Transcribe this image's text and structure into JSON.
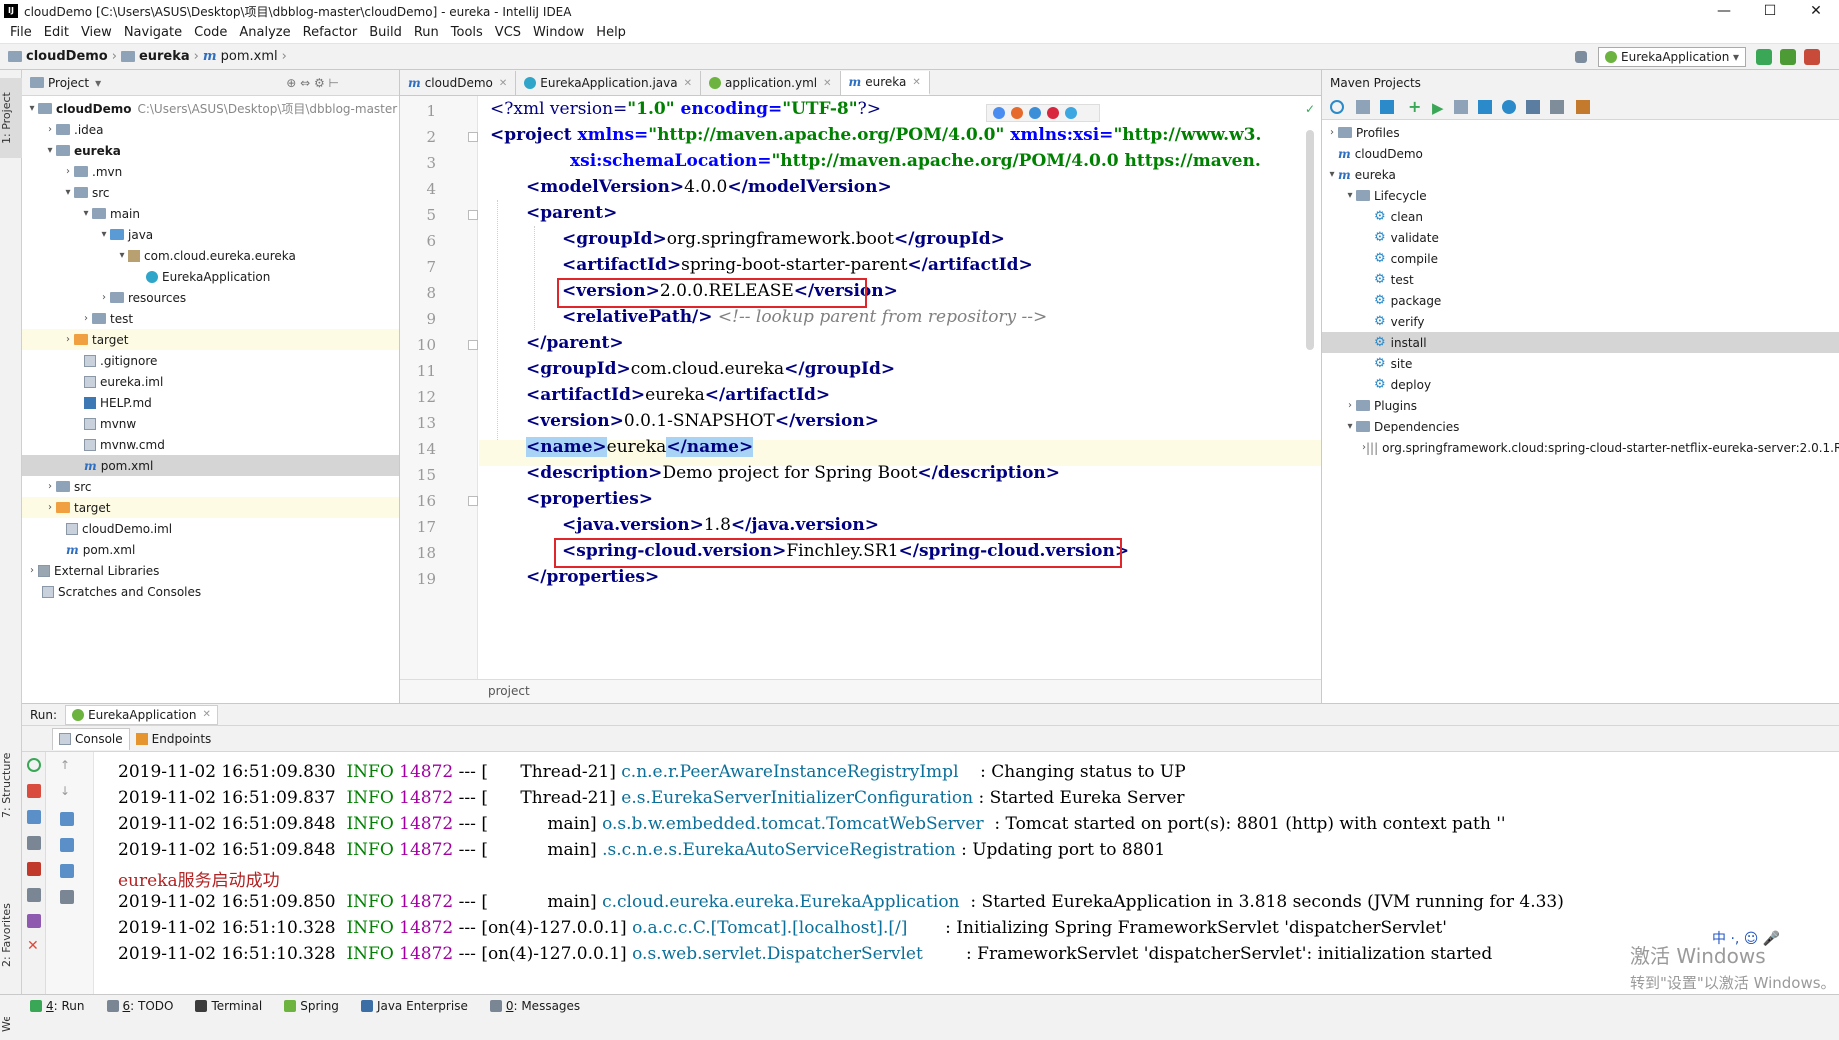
{
  "window": {
    "title": "cloudDemo [C:\\Users\\ASUS\\Desktop\\项目\\dbblog-master\\cloudDemo] - eureka - IntelliJ IDEA",
    "minimize": "—",
    "maximize": "☐",
    "close": "✕"
  },
  "menu": [
    "File",
    "Edit",
    "View",
    "Navigate",
    "Code",
    "Analyze",
    "Refactor",
    "Build",
    "Run",
    "Tools",
    "VCS",
    "Window",
    "Help"
  ],
  "breadcrumb": [
    "cloudDemo",
    "eureka",
    "pom.xml"
  ],
  "run_config": "EurekaApplication",
  "left_strip": {
    "project": "1: Project",
    "structure": "7: Structure",
    "favorites": "2: Favorites",
    "web": "Web"
  },
  "project_panel": {
    "title": "Project",
    "tree": [
      {
        "label": "cloudDemo",
        "extra": "C:\\Users\\ASUS\\Desktop\\项目\\dbblog-master",
        "bold": true
      },
      {
        "label": ".idea"
      },
      {
        "label": "eureka",
        "bold": true
      },
      {
        "label": ".mvn"
      },
      {
        "label": "src"
      },
      {
        "label": "main"
      },
      {
        "label": "java"
      },
      {
        "label": "com.cloud.eureka.eureka"
      },
      {
        "label": "EurekaApplication"
      },
      {
        "label": "resources"
      },
      {
        "label": "test"
      },
      {
        "label": "target"
      },
      {
        "label": ".gitignore"
      },
      {
        "label": "eureka.iml"
      },
      {
        "label": "HELP.md"
      },
      {
        "label": "mvnw"
      },
      {
        "label": "mvnw.cmd"
      },
      {
        "label": "pom.xml"
      },
      {
        "label": "src"
      },
      {
        "label": "target"
      },
      {
        "label": "cloudDemo.iml"
      },
      {
        "label": "pom.xml"
      },
      {
        "label": "External Libraries"
      },
      {
        "label": "Scratches and Consoles"
      }
    ]
  },
  "editor": {
    "tabs": [
      "cloudDemo",
      "EurekaApplication.java",
      "application.yml",
      "eureka"
    ],
    "active_tab": "eureka",
    "line_numbers": [
      "1",
      "2",
      "3",
      "4",
      "5",
      "6",
      "7",
      "8",
      "9",
      "10",
      "11",
      "12",
      "13",
      "14",
      "15",
      "16",
      "17",
      "18",
      "19"
    ],
    "lines": {
      "l1": [
        "<?xml version=",
        "\"1.0\"",
        " encoding=",
        "\"UTF-8\"",
        "?>"
      ],
      "l2": [
        "<project ",
        "xmlns=",
        "\"http://maven.apache.org/POM/4.0.0\"",
        " xmlns:xsi=",
        "\"http://www.w3."
      ],
      "l3": [
        "xsi:schemaLocation=",
        "\"http://maven.apache.org/POM/4.0.0 https://maven."
      ],
      "l4": [
        "<modelVersion>",
        "4.0.0",
        "</modelVersion>"
      ],
      "l5": [
        "<parent>"
      ],
      "l6": [
        "<groupId>",
        "org.springframework.boot",
        "</groupId>"
      ],
      "l7": [
        "<artifactId>",
        "spring-boot-starter-parent",
        "</artifactId>"
      ],
      "l8": [
        "<version>",
        "2.0.0.RELEASE",
        "</version>"
      ],
      "l9": [
        "<relativePath/>",
        " <!-- lookup parent from repository -->"
      ],
      "l10": [
        "</parent>"
      ],
      "l11": [
        "<groupId>",
        "com.cloud.eureka",
        "</groupId>"
      ],
      "l12": [
        "<artifactId>",
        "eureka",
        "</artifactId>"
      ],
      "l13": [
        "<version>",
        "0.0.1-SNAPSHOT",
        "</version>"
      ],
      "l14": [
        "<name>",
        "eureka",
        "</name>"
      ],
      "l15": [
        "<description>",
        "Demo project for Spring Boot",
        "</description>"
      ],
      "l16": [
        "<properties>"
      ],
      "l17": [
        "<java.version>",
        "1.8",
        "</java.version>"
      ],
      "l18": [
        "<spring-cloud.version>",
        "Finchley.SR1",
        "</spring-cloud.version>"
      ],
      "l19": [
        "</properties>"
      ]
    },
    "breadcrumb": "project"
  },
  "maven_panel": {
    "title": "Maven Projects",
    "tree": [
      {
        "label": "Profiles"
      },
      {
        "label": "cloudDemo"
      },
      {
        "label": "eureka"
      },
      {
        "label": "Lifecycle"
      },
      {
        "label": "clean"
      },
      {
        "label": "validate"
      },
      {
        "label": "compile"
      },
      {
        "label": "test"
      },
      {
        "label": "package"
      },
      {
        "label": "verify"
      },
      {
        "label": "install"
      },
      {
        "label": "site"
      },
      {
        "label": "deploy"
      },
      {
        "label": "Plugins"
      },
      {
        "label": "Dependencies"
      },
      {
        "label": "org.springframework.cloud:spring-cloud-starter-netflix-eureka-server:2.0.1.R"
      }
    ]
  },
  "run_panel": {
    "label": "Run:",
    "config": "EurekaApplication",
    "tabs": [
      "Console",
      "Endpoints"
    ],
    "log": [
      {
        "ts": "2019-11-02 16:51:09.830",
        "level": "INFO",
        "pid": "14872",
        "sep": "---",
        "thread": "[      Thread-21]",
        "logger": "c.n.e.r.PeerAwareInstanceRegistryImpl   ",
        "msg": ": Changing status to UP"
      },
      {
        "ts": "2019-11-02 16:51:09.837",
        "level": "INFO",
        "pid": "14872",
        "sep": "---",
        "thread": "[      Thread-21]",
        "logger": "e.s.EurekaServerInitializerConfiguration",
        "msg": ": Started Eureka Server"
      },
      {
        "ts": "2019-11-02 16:51:09.848",
        "level": "INFO",
        "pid": "14872",
        "sep": "---",
        "thread": "[           main]",
        "logger": "o.s.b.w.embedded.tomcat.TomcatWebServer ",
        "msg": ": Tomcat started on port(s): 8801 (http) with context path ''"
      },
      {
        "ts": "2019-11-02 16:51:09.848",
        "level": "INFO",
        "pid": "14872",
        "sep": "---",
        "thread": "[           main]",
        "logger": ".s.c.n.e.s.EurekaAutoServiceRegistration",
        "msg": ": Updating port to 8801"
      },
      {
        "plain": "eureka服务启动成功"
      },
      {
        "ts": "2019-11-02 16:51:09.850",
        "level": "INFO",
        "pid": "14872",
        "sep": "---",
        "thread": "[           main]",
        "logger": "c.cloud.eureka.eureka.EurekaApplication ",
        "msg": ": Started EurekaApplication in 3.818 seconds (JVM running for 4.33)"
      },
      {
        "ts": "2019-11-02 16:51:10.328",
        "level": "INFO",
        "pid": "14872",
        "sep": "---",
        "thread": "[on(4)-127.0.0.1]",
        "logger": "o.a.c.c.C.[Tomcat].[localhost].[/]      ",
        "msg": ": Initializing Spring FrameworkServlet 'dispatcherServlet'"
      },
      {
        "ts": "2019-11-02 16:51:10.328",
        "level": "INFO",
        "pid": "14872",
        "sep": "---",
        "thread": "[on(4)-127.0.0.1]",
        "logger": "o.s.web.servlet.DispatcherServlet       ",
        "msg": ": FrameworkServlet 'dispatcherServlet': initialization started"
      }
    ]
  },
  "statusbar": [
    {
      "num": "4",
      "label": ": Run"
    },
    {
      "num": "6",
      "label": ": TODO"
    },
    {
      "num": "",
      "label": "Terminal"
    },
    {
      "num": "",
      "label": "Spring"
    },
    {
      "num": "",
      "label": "Java Enterprise"
    },
    {
      "num": "0",
      "label": ": Messages"
    }
  ],
  "watermark": {
    "line1": "激活 Windows",
    "line2": "转到\"设置\"以激活 Windows。"
  },
  "ime": "中 ·, ☺ 🎤",
  "colors": {
    "highlight_row": "#fdfbe3",
    "selection": "#d5d5d5",
    "red_box": "#e0262b",
    "tag": "#000080",
    "string": "#008000"
  }
}
